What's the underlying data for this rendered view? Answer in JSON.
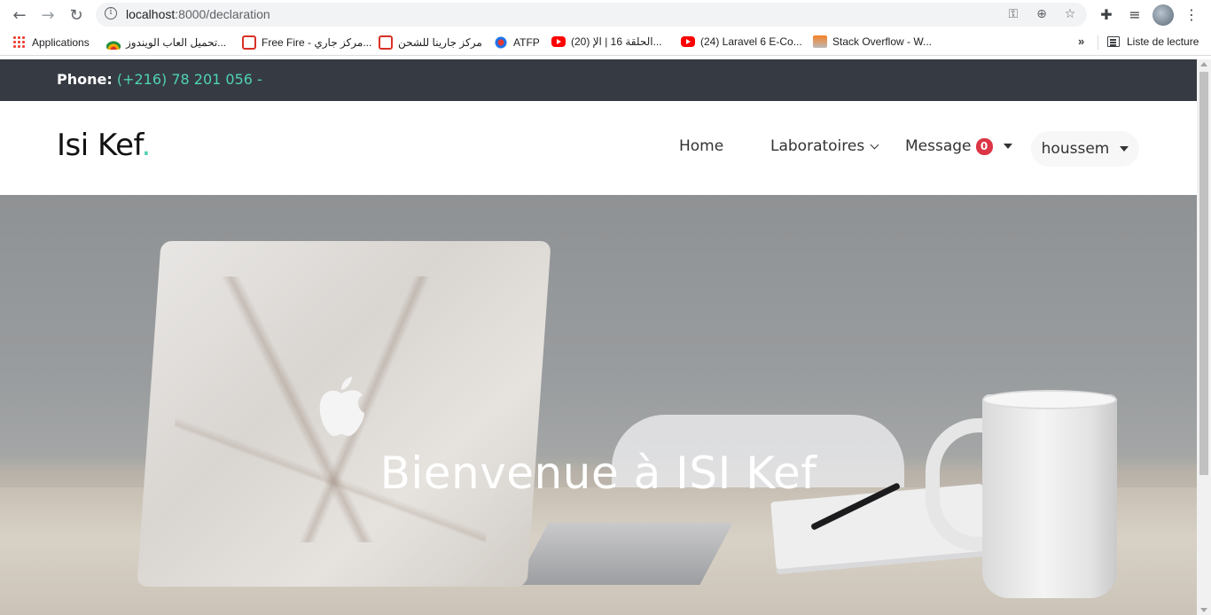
{
  "browser": {
    "url_host": "localhost",
    "url_path": ":8000/declaration",
    "bookmarks": [
      {
        "label": "Applications",
        "icon": "apps-grid-icon"
      },
      {
        "label": "تحميل العاب الويندوز...",
        "icon": "wifi-icon"
      },
      {
        "label": "Free Fire - مركز جاري...",
        "icon": "freefire-icon"
      },
      {
        "label": "مركز جارينا للشحن",
        "icon": "garena-icon"
      },
      {
        "label": "ATFP",
        "icon": "atfp-icon"
      },
      {
        "label": "(20) الحلقة 16 | الإ...",
        "icon": "youtube-icon"
      },
      {
        "label": "(24) Laravel 6 E-Co...",
        "icon": "youtube-icon"
      },
      {
        "label": "Stack Overflow - W...",
        "icon": "stackoverflow-icon"
      }
    ],
    "more_bookmarks": "»",
    "reading_list": "Liste de lecture"
  },
  "topbar": {
    "phone_label": "Phone:",
    "phone_number": "(+216) 78 201 056 -"
  },
  "navbar": {
    "brand": "Isi Kef",
    "brand_dot": ".",
    "home": "Home",
    "labs": "Laboratoires",
    "message": "Message",
    "message_count": "0",
    "user": "houssem"
  },
  "hero": {
    "title": "Bienvenue à ISI Kef"
  },
  "colors": {
    "accent": "#4fd1b5",
    "topbar_bg": "#363b43",
    "badge": "#dc3545"
  }
}
